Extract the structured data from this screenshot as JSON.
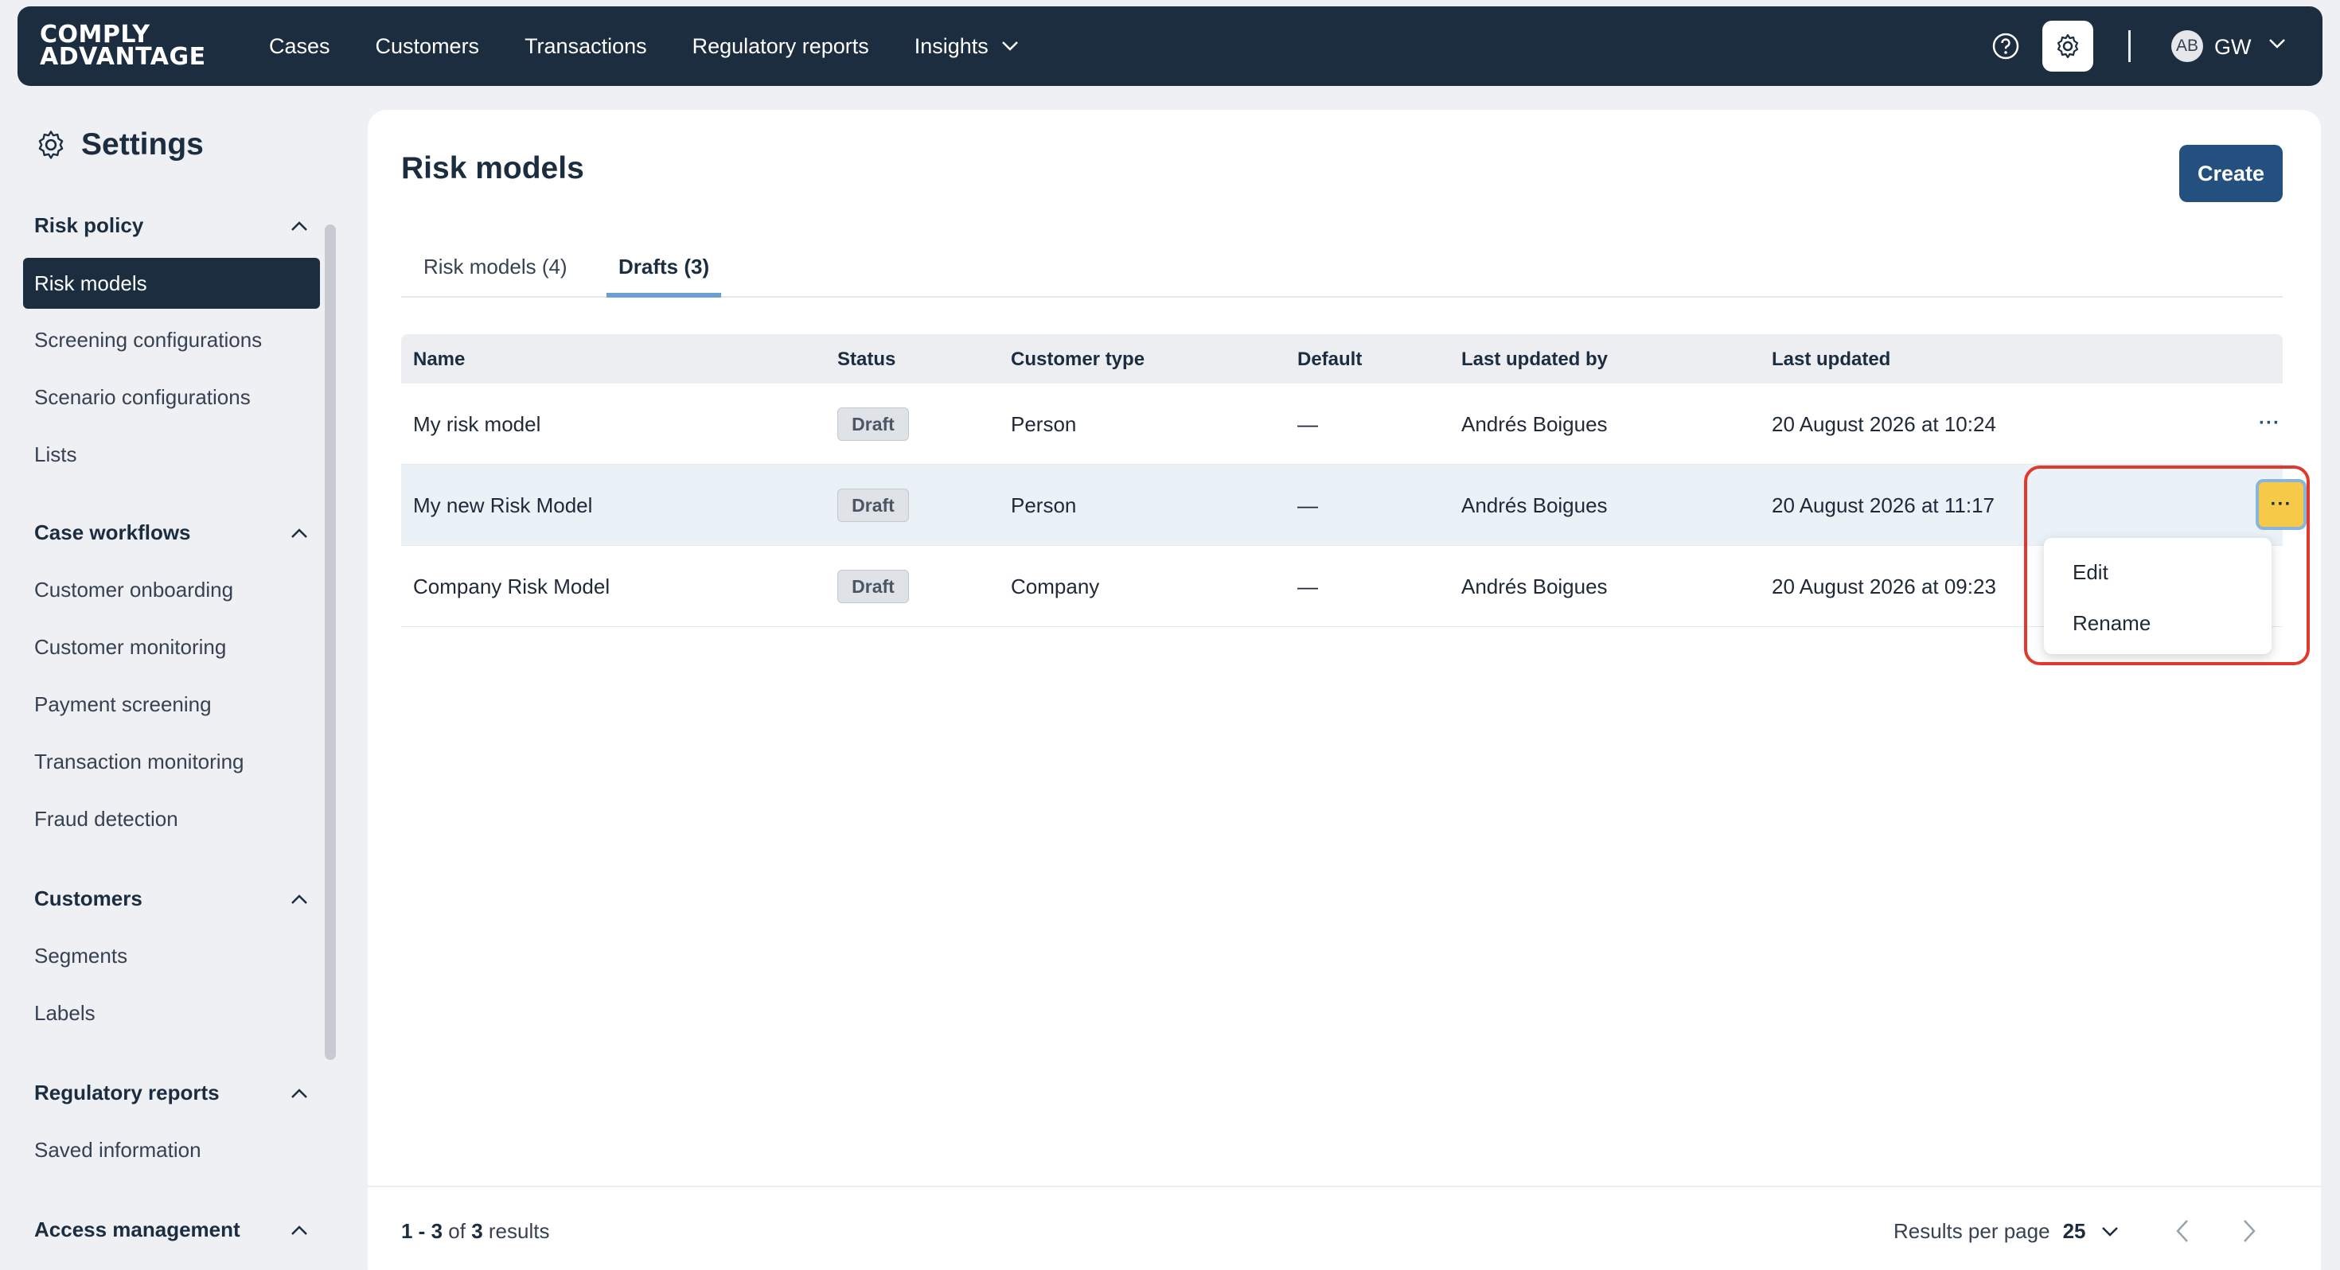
{
  "app": {
    "logo_line1": "COMPLY",
    "logo_line2": "ADVANTAGE"
  },
  "topnav": {
    "items": [
      {
        "label": "Cases"
      },
      {
        "label": "Customers"
      },
      {
        "label": "Transactions"
      },
      {
        "label": "Regulatory reports"
      },
      {
        "label": "Insights",
        "has_dropdown": true
      }
    ],
    "avatar_initials": "AB",
    "user_initials": "GW"
  },
  "sidebar": {
    "title": "Settings",
    "sections": [
      {
        "label": "Risk policy",
        "expanded": true,
        "items": [
          "Risk models",
          "Screening configurations",
          "Scenario configurations",
          "Lists"
        ],
        "active": "Risk models"
      },
      {
        "label": "Case workflows",
        "expanded": true,
        "items": [
          "Customer onboarding",
          "Customer monitoring",
          "Payment screening",
          "Transaction monitoring",
          "Fraud detection"
        ]
      },
      {
        "label": "Customers",
        "expanded": true,
        "items": [
          "Segments",
          "Labels"
        ]
      },
      {
        "label": "Regulatory reports",
        "expanded": true,
        "items": [
          "Saved information"
        ]
      },
      {
        "label": "Access management",
        "expanded": true,
        "items": []
      }
    ]
  },
  "main": {
    "title": "Risk models",
    "create_label": "Create",
    "tabs": [
      {
        "label": "Risk models (4)",
        "active": false
      },
      {
        "label": "Drafts (3)",
        "active": true
      }
    ],
    "table": {
      "columns": [
        "Name",
        "Status",
        "Customer type",
        "Default",
        "Last updated by",
        "Last updated"
      ],
      "rows": [
        {
          "name": "My risk model",
          "status": "Draft",
          "customer_type": "Person",
          "default": "—",
          "updated_by": "Andrés Boigues",
          "updated": "20 August 2026 at 10:24",
          "menu": "···"
        },
        {
          "name": "My new Risk Model",
          "status": "Draft",
          "customer_type": "Person",
          "default": "—",
          "updated_by": "Andrés Boigues",
          "updated": "20 August 2026 at 11:17",
          "menu": "···"
        },
        {
          "name": "Company Risk Model",
          "status": "Draft",
          "customer_type": "Company",
          "default": "—",
          "updated_by": "Andrés Boigues",
          "updated": "20 August 2026 at 09:23",
          "menu": "···"
        }
      ]
    },
    "row_menu": {
      "items": [
        "Edit",
        "Rename"
      ]
    },
    "footer": {
      "range": "1 - 3",
      "of": "of",
      "total": "3",
      "results_word": "results",
      "per_page_label": "Results per page",
      "per_page_value": "25"
    }
  },
  "colors": {
    "navbar": "#1c2d40",
    "primary_button": "#24507f",
    "active_menu_button": "#f7c948",
    "highlight_outline": "#e03a2f",
    "tab_underline": "#6b9fd1"
  }
}
